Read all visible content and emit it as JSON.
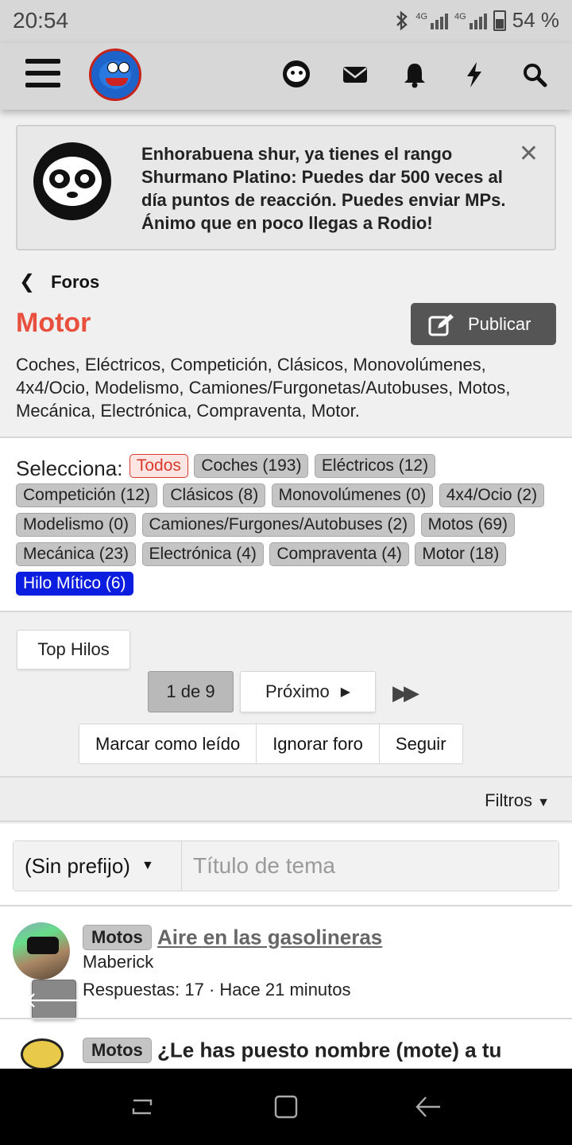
{
  "status_bar": {
    "time": "20:54",
    "network": "4G",
    "battery": "54 %"
  },
  "notice": {
    "message": "Enhorabuena shur, ya tienes el rango Shurmano Platino: Puedes dar 500 veces al día puntos de reacción. Puedes enviar MPs. Ánimo que en poco llegas a Rodio!",
    "close": "✕"
  },
  "breadcrumb": {
    "label": "Foros"
  },
  "forum": {
    "title": "Motor",
    "description": "Coches, Eléctricos, Competición, Clásicos, Monovolúmenes, 4x4/Ocio, Modelismo, Camiones/Furgonetas/Autobuses, Motos, Mecánica, Electrónica, Compraventa, Motor."
  },
  "publish_label": "Publicar",
  "tags": {
    "label": "Selecciona:",
    "items": [
      {
        "label": "Todos"
      },
      {
        "label": "Coches (193)"
      },
      {
        "label": "Eléctricos (12)"
      },
      {
        "label": "Competición (12)"
      },
      {
        "label": "Clásicos (8)"
      },
      {
        "label": "Monovolúmenes (0)"
      },
      {
        "label": "4x4/Ocio (2)"
      },
      {
        "label": "Modelismo (0)"
      },
      {
        "label": "Camiones/Furgones/Autobuses (2)"
      },
      {
        "label": "Motos (69)"
      },
      {
        "label": "Mecánica (23)"
      },
      {
        "label": "Electrónica (4)"
      },
      {
        "label": "Compraventa (4)"
      },
      {
        "label": "Motor (18)"
      },
      {
        "label": "Hilo Mítico (6)"
      }
    ]
  },
  "top_hilos_label": "Top Hilos",
  "pagination": {
    "current": "1 de 9",
    "next": "Próximo"
  },
  "actions": {
    "mark_read": "Marcar como leído",
    "ignore": "Ignorar foro",
    "follow": "Seguir"
  },
  "filters_label": "Filtros",
  "new_thread": {
    "prefix": "(Sin prefijo)",
    "placeholder": "Título de tema"
  },
  "threads": [
    {
      "prefix": "Motos",
      "title": "Aire en las gasolineras",
      "author": "Maberick",
      "meta": "Respuestas: 17 · Hace 21 minutos"
    },
    {
      "prefix": "Motos",
      "title": "¿Le has puesto nombre (mote) a tu"
    }
  ],
  "colors": {
    "accent": "#e8503d",
    "mitico": "#0b1ee0",
    "header_bg": "#d7d7d7"
  }
}
